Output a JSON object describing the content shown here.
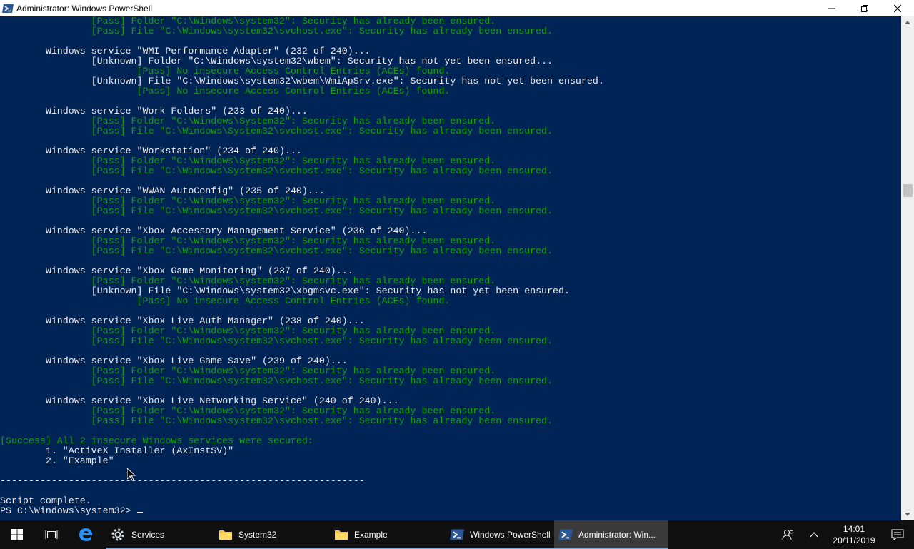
{
  "window": {
    "title": "Administrator: Windows PowerShell",
    "minimize_glyph": "—",
    "maximize_glyph": "❐",
    "close_glyph": "✕"
  },
  "console": {
    "lines": [
      {
        "text": "                [Pass] Folder \"C:\\Windows\\system32\": Security has already been ensured.",
        "color": "green"
      },
      {
        "text": "                [Pass] File \"C:\\Windows\\system32\\svchost.exe\": Security has already been ensured.",
        "color": "green"
      },
      {
        "text": "",
        "color": "white"
      },
      {
        "text": "        Windows service \"WMI Performance Adapter\" (232 of 240)...",
        "color": "white"
      },
      {
        "text": "                [Unknown] Folder \"C:\\Windows\\system32\\wbem\": Security has not yet been ensured...",
        "color": "white"
      },
      {
        "text": "                        [Pass] No insecure Access Control Entries (ACEs) found.",
        "color": "green"
      },
      {
        "text": "                [Unknown] File \"C:\\Windows\\system32\\wbem\\WmiApSrv.exe\": Security has not yet been ensured.",
        "color": "white"
      },
      {
        "text": "                        [Pass] No insecure Access Control Entries (ACEs) found.",
        "color": "green"
      },
      {
        "text": "",
        "color": "white"
      },
      {
        "text": "        Windows service \"Work Folders\" (233 of 240)...",
        "color": "white"
      },
      {
        "text": "                [Pass] Folder \"C:\\Windows\\System32\": Security has already been ensured.",
        "color": "green"
      },
      {
        "text": "                [Pass] File \"C:\\Windows\\System32\\svchost.exe\": Security has already been ensured.",
        "color": "green"
      },
      {
        "text": "",
        "color": "white"
      },
      {
        "text": "        Windows service \"Workstation\" (234 of 240)...",
        "color": "white"
      },
      {
        "text": "                [Pass] Folder \"C:\\Windows\\System32\": Security has already been ensured.",
        "color": "green"
      },
      {
        "text": "                [Pass] File \"C:\\Windows\\System32\\svchost.exe\": Security has already been ensured.",
        "color": "green"
      },
      {
        "text": "",
        "color": "white"
      },
      {
        "text": "        Windows service \"WWAN AutoConfig\" (235 of 240)...",
        "color": "white"
      },
      {
        "text": "                [Pass] Folder \"C:\\Windows\\system32\": Security has already been ensured.",
        "color": "green"
      },
      {
        "text": "                [Pass] File \"C:\\Windows\\system32\\svchost.exe\": Security has already been ensured.",
        "color": "green"
      },
      {
        "text": "",
        "color": "white"
      },
      {
        "text": "        Windows service \"Xbox Accessory Management Service\" (236 of 240)...",
        "color": "white"
      },
      {
        "text": "                [Pass] Folder \"C:\\Windows\\system32\": Security has already been ensured.",
        "color": "green"
      },
      {
        "text": "                [Pass] File \"C:\\Windows\\system32\\svchost.exe\": Security has already been ensured.",
        "color": "green"
      },
      {
        "text": "",
        "color": "white"
      },
      {
        "text": "        Windows service \"Xbox Game Monitoring\" (237 of 240)...",
        "color": "white"
      },
      {
        "text": "                [Pass] Folder \"C:\\Windows\\system32\": Security has already been ensured.",
        "color": "green"
      },
      {
        "text": "                [Unknown] File \"C:\\Windows\\system32\\xbgmsvc.exe\": Security has not yet been ensured.",
        "color": "white"
      },
      {
        "text": "                        [Pass] No insecure Access Control Entries (ACEs) found.",
        "color": "green"
      },
      {
        "text": "",
        "color": "white"
      },
      {
        "text": "        Windows service \"Xbox Live Auth Manager\" (238 of 240)...",
        "color": "white"
      },
      {
        "text": "                [Pass] Folder \"C:\\Windows\\system32\": Security has already been ensured.",
        "color": "green"
      },
      {
        "text": "                [Pass] File \"C:\\Windows\\system32\\svchost.exe\": Security has already been ensured.",
        "color": "green"
      },
      {
        "text": "",
        "color": "white"
      },
      {
        "text": "        Windows service \"Xbox Live Game Save\" (239 of 240)...",
        "color": "white"
      },
      {
        "text": "                [Pass] Folder \"C:\\Windows\\system32\": Security has already been ensured.",
        "color": "green"
      },
      {
        "text": "                [Pass] File \"C:\\Windows\\system32\\svchost.exe\": Security has already been ensured.",
        "color": "green"
      },
      {
        "text": "",
        "color": "white"
      },
      {
        "text": "        Windows service \"Xbox Live Networking Service\" (240 of 240)...",
        "color": "white"
      },
      {
        "text": "                [Pass] Folder \"C:\\Windows\\system32\": Security has already been ensured.",
        "color": "green"
      },
      {
        "text": "                [Pass] File \"C:\\Windows\\system32\\svchost.exe\": Security has already been ensured.",
        "color": "green"
      },
      {
        "text": "",
        "color": "white"
      },
      {
        "text": "[Success] All 2 insecure Windows services were secured:",
        "color": "green"
      },
      {
        "text": "        1. \"ActiveX Installer (AxInstSV)\"",
        "color": "white"
      },
      {
        "text": "        2. \"Example\"",
        "color": "white"
      },
      {
        "text": "",
        "color": "white"
      },
      {
        "text": "----------------------------------------------------------------",
        "color": "white"
      },
      {
        "text": "",
        "color": "white"
      },
      {
        "text": "Script complete.",
        "color": "white"
      },
      {
        "text": "PS C:\\Windows\\system32> ",
        "color": "white"
      }
    ]
  },
  "taskbar": {
    "apps": [
      {
        "label": "Services",
        "icon": "gear-icon",
        "active": false,
        "running": true
      },
      {
        "label": "System32",
        "icon": "folder-icon",
        "active": false,
        "running": true
      },
      {
        "label": "Example",
        "icon": "folder-icon",
        "active": false,
        "running": true
      },
      {
        "label": "Windows PowerShell",
        "icon": "powershell-icon",
        "active": false,
        "running": true
      },
      {
        "label": "Administrator: Win...",
        "icon": "powershell-icon",
        "active": true,
        "running": true
      }
    ],
    "clock": {
      "time": "14:01",
      "date": "20/11/2019"
    }
  },
  "colors": {
    "console_bg": "#012456",
    "console_text": "#eeedf0",
    "pass_green": "#13a10e",
    "taskbar_bg": "#101010"
  }
}
